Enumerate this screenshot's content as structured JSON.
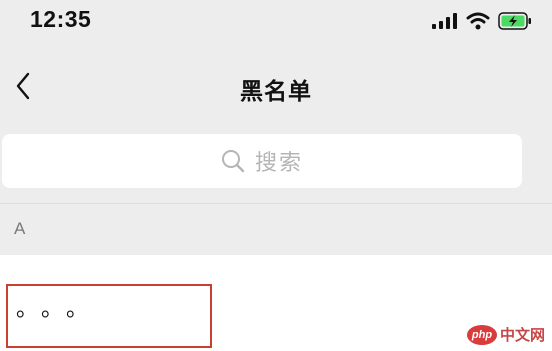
{
  "status_bar": {
    "time": "12:35",
    "icons": [
      "signal-icon",
      "wifi-icon",
      "battery-charging-icon"
    ],
    "battery_color": "#4cd964"
  },
  "nav": {
    "back_icon": "chevron-left-icon",
    "title": "黑名单"
  },
  "search": {
    "icon": "search-icon",
    "placeholder": "搜索"
  },
  "list": {
    "section_header": "A",
    "items": [
      {
        "name": "。。。",
        "highlighted": true,
        "highlight_color": "#c9402f"
      }
    ]
  },
  "watermark": {
    "logo_text": "php",
    "text": "中文网"
  }
}
